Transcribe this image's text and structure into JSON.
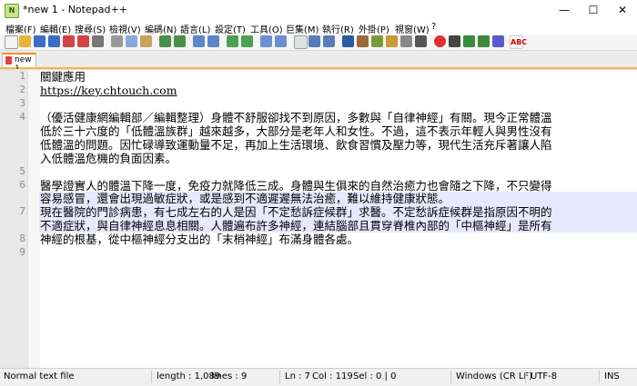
{
  "window": {
    "title": "*new 1 - Notepad++",
    "minimize": "—",
    "maximize": "☐",
    "close": "✕"
  },
  "menu": [
    "檔案(F)",
    "編輯(E)",
    "搜尋(S)",
    "檢視(V)",
    "編碼(N)",
    "語言(L)",
    "設定(T)",
    "工具(O)",
    "巨集(M)",
    "執行(R)",
    "外掛(P)",
    "視窗(W)",
    "?"
  ],
  "tab": {
    "label": "new 1"
  },
  "editor": {
    "line_numbers": [
      "1",
      "2",
      "3",
      "4",
      "",
      "",
      "5",
      "6",
      "",
      "7",
      "",
      "",
      "8",
      "9"
    ],
    "lines": [
      "關鍵應用",
      "https://key.chtouch.com",
      "",
      "（優活健康網編輯部／編輯整理）身體不舒服卻找不到原因，多數與「自律神經」有關。現今正常體溫",
      "低於三十六度的「低體溫族群」越來越多，大部分是老年人和女性。不過，這不表示年輕人與男性沒有",
      "低體溫的問題。因忙碌導致運動量不足，再加上生活環境、飲食習慣及壓力等，現代生活充斥著讓人陷",
      "入低體溫危機的負面因素。",
      "",
      "醫學證實人的體溫下降一度，免疫力就降低三成。身體與生俱來的自然治癒力也會隨之下降，不只變得",
      "容易感冒，還會出現過敏症狀，或是感到不適遲遲無法治癒，難以維持健康狀態。",
      "現在醫院的門診病患，有七成左右的人是因「不定愁訴症候群」求醫。不定愁訴症候群是指原因不明的",
      "不適症狀，與自律神經息息相關。人體遍布許多神經，連結腦部且貫穿脊椎內部的「中樞神經」是所有",
      "神經的根基，從中樞神經分支出的「末梢神經」布滿身體各處。",
      "",
      ""
    ]
  },
  "status": {
    "file_type": "Normal text file",
    "length": "length : 1,089",
    "lines": "lines : 9",
    "ln": "Ln : 7",
    "col": "Col : 119",
    "sel": "Sel : 0 | 0",
    "eol": "Windows (CR LF)",
    "encoding": "UTF-8",
    "mode": "INS"
  },
  "colors": {
    "tab_accent": "#f48c1a",
    "current_line": "#e8e8ff",
    "gutter": "#e8e8e8"
  }
}
